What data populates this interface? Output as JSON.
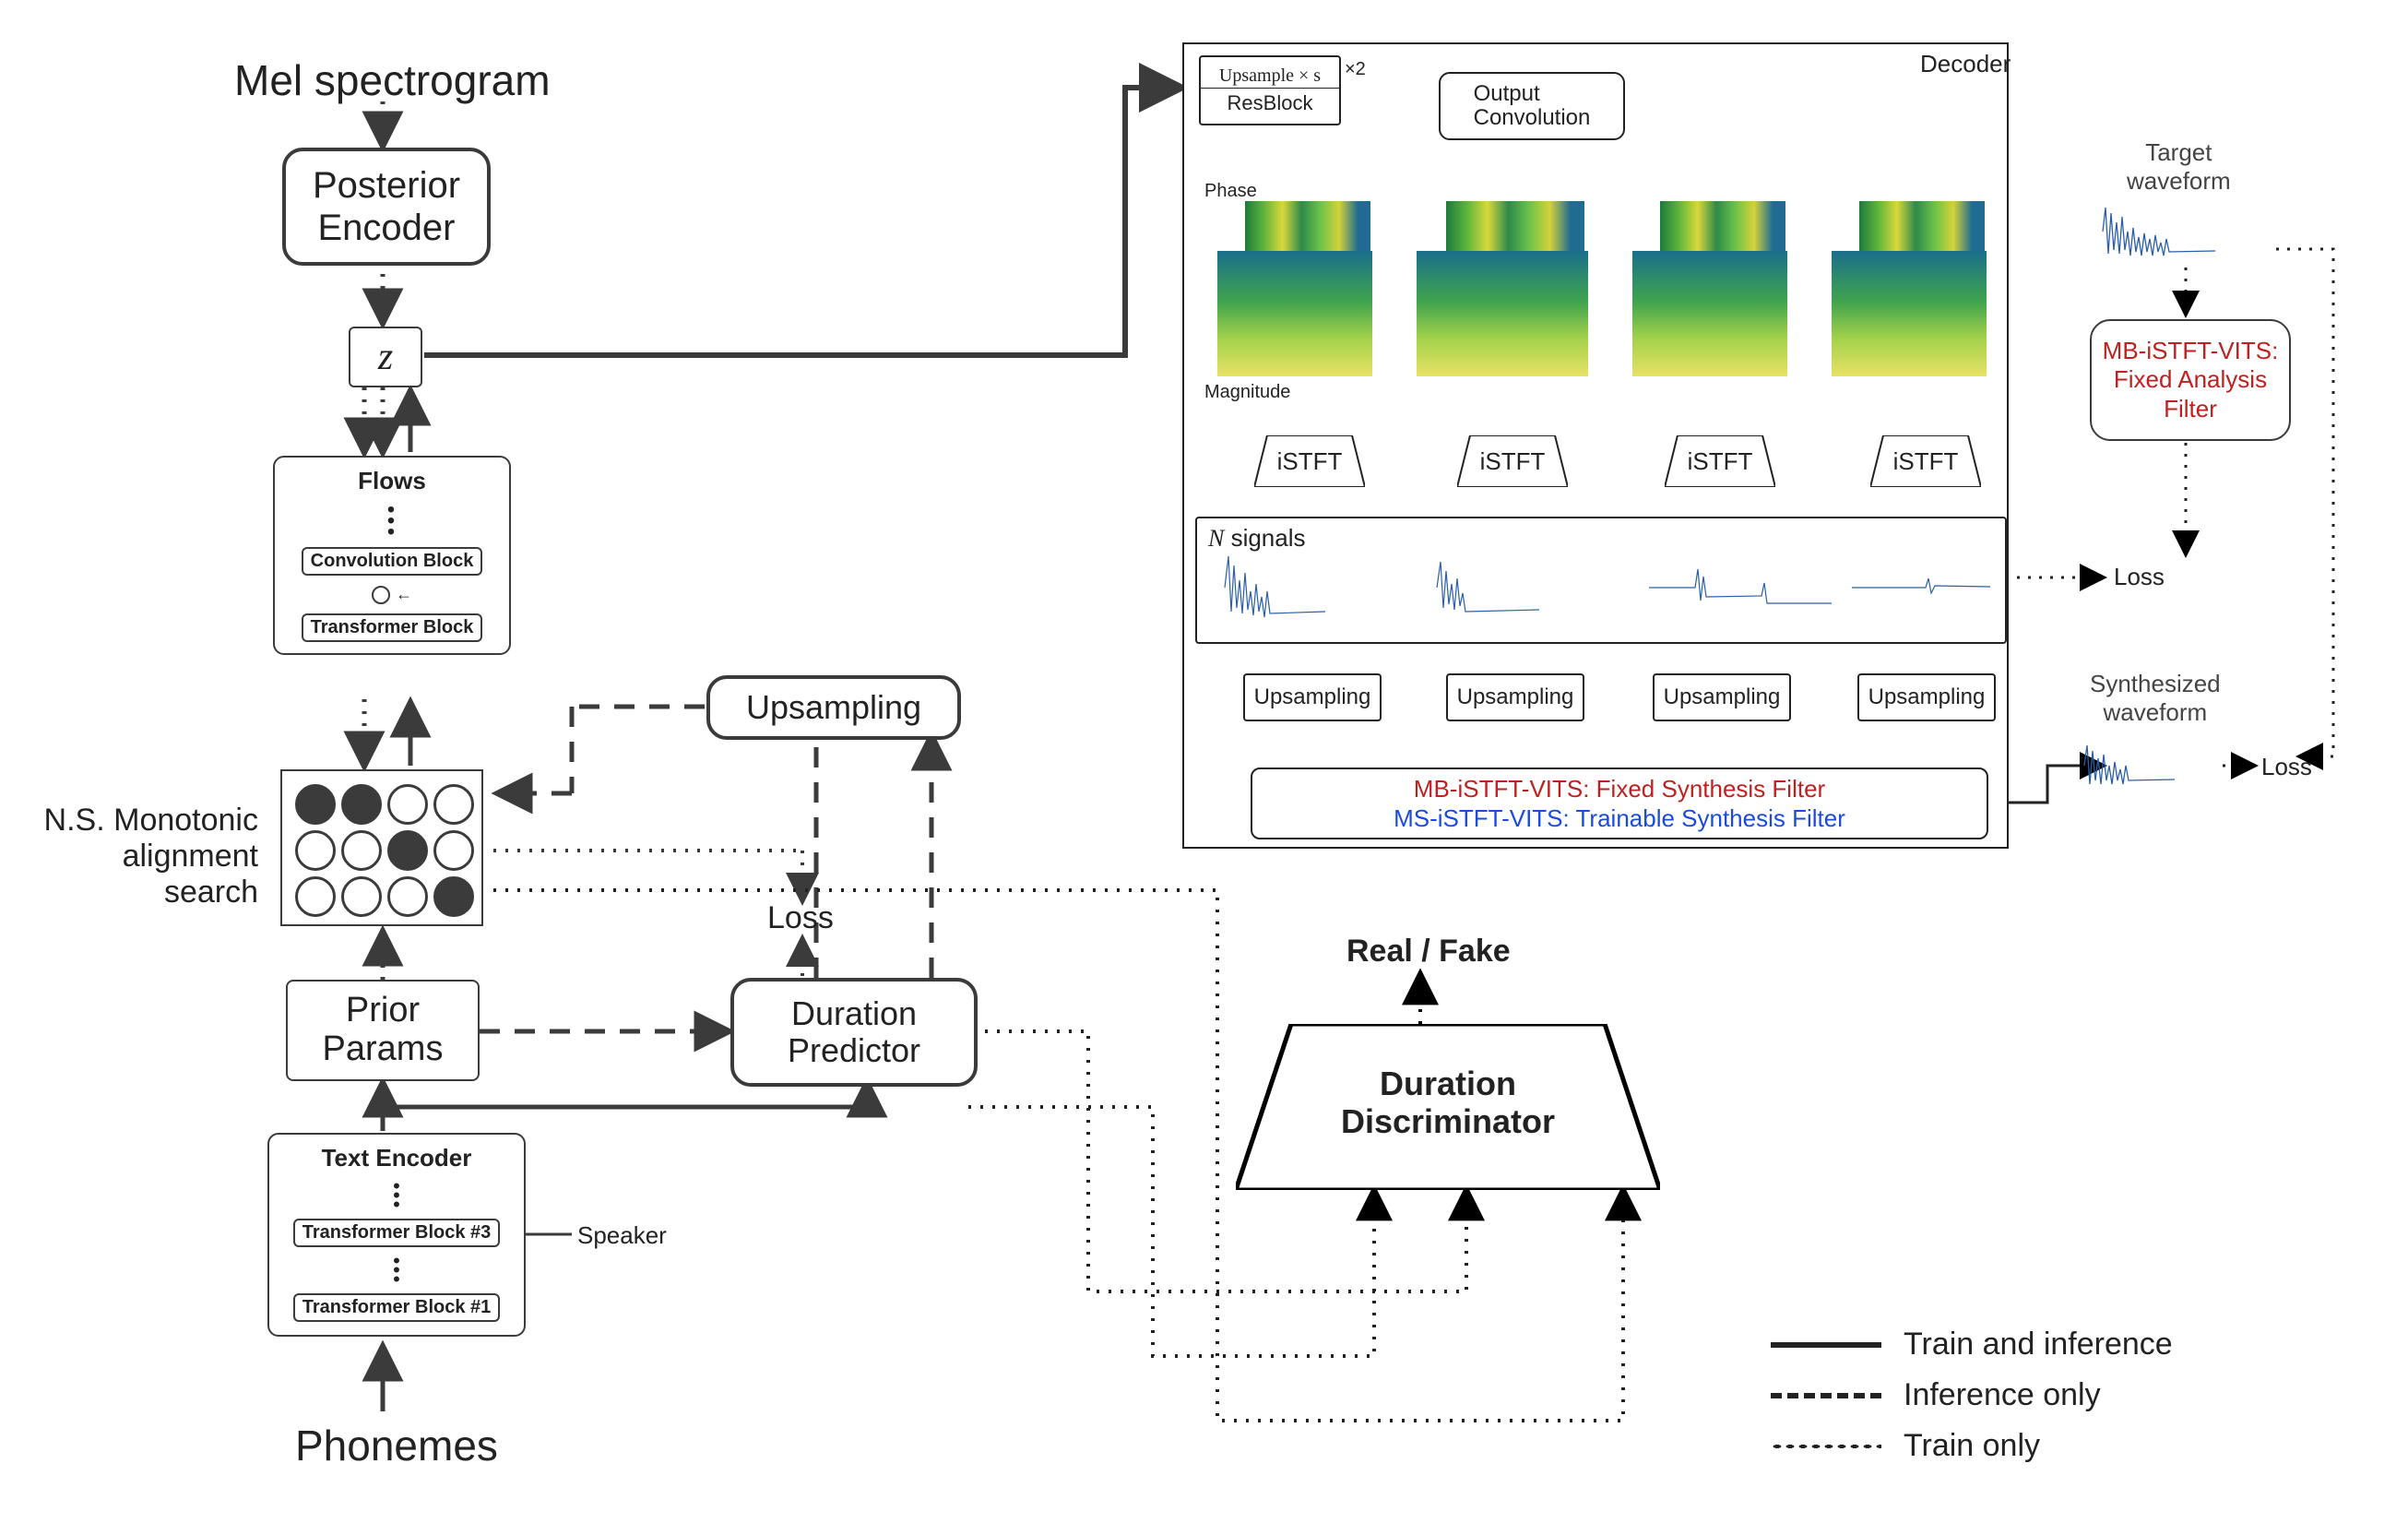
{
  "inputs": {
    "mel": "Mel spectrogram",
    "phonemes": "Phonemes",
    "speaker": "Speaker"
  },
  "blocks": {
    "posterior_encoder": "Posterior\nEncoder",
    "z": "z",
    "flows_title": "Flows",
    "flows_conv": "Convolution Block",
    "flows_tx": "Transformer Block",
    "alignment_label": "N.S. Monotonic\nalignment search",
    "prior_params": "Prior\nParams",
    "text_encoder_title": "Text Encoder",
    "tx3": "Transformer Block #3",
    "tx1": "Transformer Block #1",
    "upsampling": "Upsampling",
    "duration_predictor": "Duration\nPredictor",
    "loss": "Loss",
    "real_fake": "Real / Fake",
    "duration_discriminator": "Duration\nDiscriminator"
  },
  "decoder": {
    "title": "Decoder",
    "upsample_s": "Upsample × s",
    "times2": "×2",
    "resblock": "ResBlock",
    "output_conv": "Output\nConvolution",
    "phase": "Phase",
    "magnitude": "Magnitude",
    "istft": "iSTFT",
    "n_signals_prefix": "N",
    "n_signals_suffix": " signals",
    "upsampling": "Upsampling",
    "synth_mb": "MB-iSTFT-VITS: Fixed Synthesis Filter",
    "synth_ms": "MS-iSTFT-VITS: Trainable Synthesis Filter"
  },
  "right": {
    "target": "Target\nwaveform",
    "analysis_mb": "MB-iSTFT-VITS:\nFixed Analysis\nFilter",
    "loss1": "Loss",
    "synth_label": "Synthesized\nwaveform",
    "loss2": "Loss"
  },
  "legend": {
    "solid": "Train and inference",
    "dash": "Inference only",
    "dot": "Train only"
  }
}
